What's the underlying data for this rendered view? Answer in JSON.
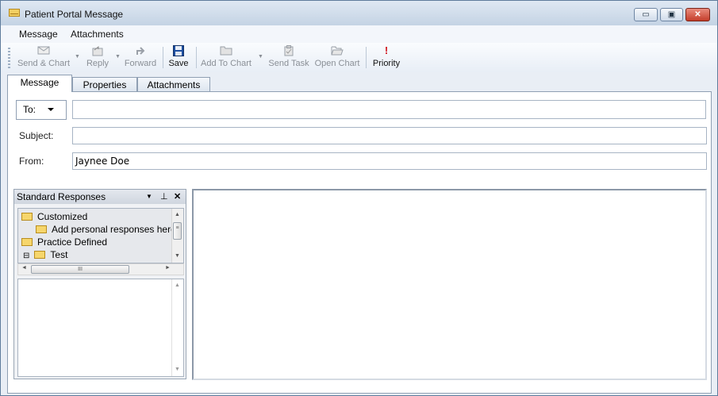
{
  "window": {
    "title": "Patient Portal Message",
    "minimize_glyph": "▭",
    "maximize_glyph": "▣",
    "close_glyph": "✕"
  },
  "menu": {
    "items": [
      "Message",
      "Attachments"
    ]
  },
  "toolbar": {
    "send_chart": "Send & Chart",
    "reply": "Reply",
    "forward": "Forward",
    "save": "Save",
    "add_to_chart": "Add To Chart",
    "send_task": "Send Task",
    "open_chart": "Open Chart",
    "priority": "Priority",
    "priority_glyph": "!",
    "dropdown_glyph": "▼"
  },
  "tabs": [
    "Message",
    "Properties",
    "Attachments"
  ],
  "form": {
    "to_label": "To:",
    "to_value": "",
    "subject_label": "Subject:",
    "subject_value": "",
    "from_label": "From:",
    "from_value": "Jaynee Doe"
  },
  "standard_responses": {
    "title": "Standard Responses",
    "header_glyphs": {
      "dropdown": "▼",
      "pin": "⊥",
      "close": "✕"
    },
    "tree": [
      {
        "label": "Customized",
        "level": 0
      },
      {
        "label": "Add personal responses here...",
        "level": 1
      },
      {
        "label": "Practice Defined",
        "level": 0
      },
      {
        "label": "Test",
        "level": 1,
        "expander": "⊟"
      }
    ],
    "scroll_glyphs": {
      "up": "▲",
      "down": "▼",
      "left": "◄",
      "right": "►",
      "thumb": "III"
    }
  },
  "colors": {
    "window_bg": "#e9eef5",
    "title_bar": "#c4d3e4",
    "close_button": "#c43d2a",
    "save_icon": "#1e4fa0",
    "priority_icon": "#d0121b",
    "folder": "#f6d66c"
  },
  "icons": {
    "send_chart": "envelope-chart-icon",
    "reply": "reply-icon",
    "forward": "forward-arrow-icon",
    "save": "floppy-disk-icon",
    "add_to_chart": "folder-icon",
    "send_task": "clipboard-icon",
    "open_chart": "open-folder-icon",
    "priority": "exclamation-icon"
  }
}
